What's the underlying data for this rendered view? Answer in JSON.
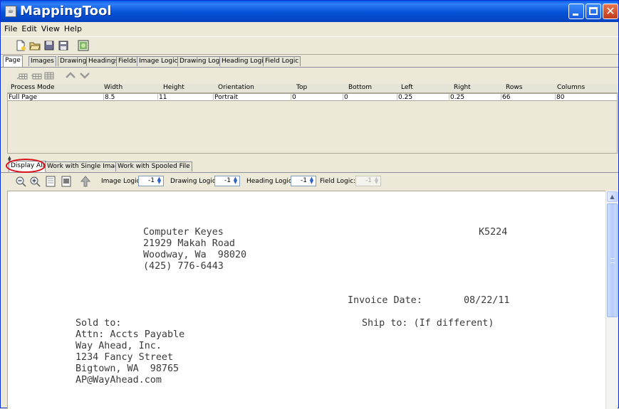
{
  "window": {
    "title": "MappingTool"
  },
  "menu": {
    "items": [
      "File",
      "Edit",
      "View",
      "Help"
    ]
  },
  "toolbar": {
    "icons": [
      "new-document-icon",
      "open-folder-icon",
      "save-icon",
      "save-as-icon",
      "image-icon"
    ]
  },
  "tabs": [
    "Page",
    "Images",
    "Drawings",
    "Headings",
    "Fields",
    "Image Logic",
    "Drawing Logic",
    "Heading Logic",
    "Field Logic"
  ],
  "row_toolbar": {
    "icons": [
      "insert-row-icon",
      "add-row-icon",
      "delete-row-icon",
      "move-up-icon",
      "move-down-icon"
    ]
  },
  "page_table": {
    "columns": [
      "Process Mode",
      "Width",
      "Height",
      "Orientation",
      "Top",
      "Bottom",
      "Left",
      "Right",
      "Rows",
      "Columns"
    ],
    "rows": [
      [
        "Full Page",
        "8.5",
        "11",
        "Portrait",
        "0",
        "0",
        "0.25",
        "0.25",
        "66",
        "80"
      ]
    ]
  },
  "view_tabs": [
    "Display All",
    "Work with Single Image",
    "Work with Spooled File"
  ],
  "view_toolbar": {
    "icons": [
      "zoom-out-icon",
      "zoom-in-icon",
      "fit-page-icon",
      "actual-size-icon",
      "upload-icon"
    ],
    "image_logic_label": "Image Logic:",
    "image_logic_value": "-1",
    "drawing_logic_label": "Drawing Logic:",
    "drawing_logic_value": "-1",
    "heading_logic_label": "Heading Logic:",
    "heading_logic_value": "-1",
    "field_logic_label": "Field Logic:",
    "field_logic_value": "-1"
  },
  "document": {
    "company": "Computer Keyes",
    "address1": "21929 Makah Road",
    "city_line": "Woodway, Wa  98020",
    "phone": "(425) 776-6443",
    "code": "K5224",
    "invoice_date_label": "Invoice Date:",
    "invoice_date": "08/22/11",
    "sold_to": "Sold to:",
    "ship_to": "Ship to: (If different)",
    "attn": "Attn: Accts Payable",
    "customer": "Way Ahead, Inc.",
    "cust_street": "1234 Fancy Street",
    "cust_city": "Bigtown, WA  98765",
    "cust_email": "AP@WayAhead.com"
  },
  "colors": {
    "title_bar": "#0553d6",
    "close_button": "#c2391a",
    "highlight_circle": "#d9131c"
  }
}
